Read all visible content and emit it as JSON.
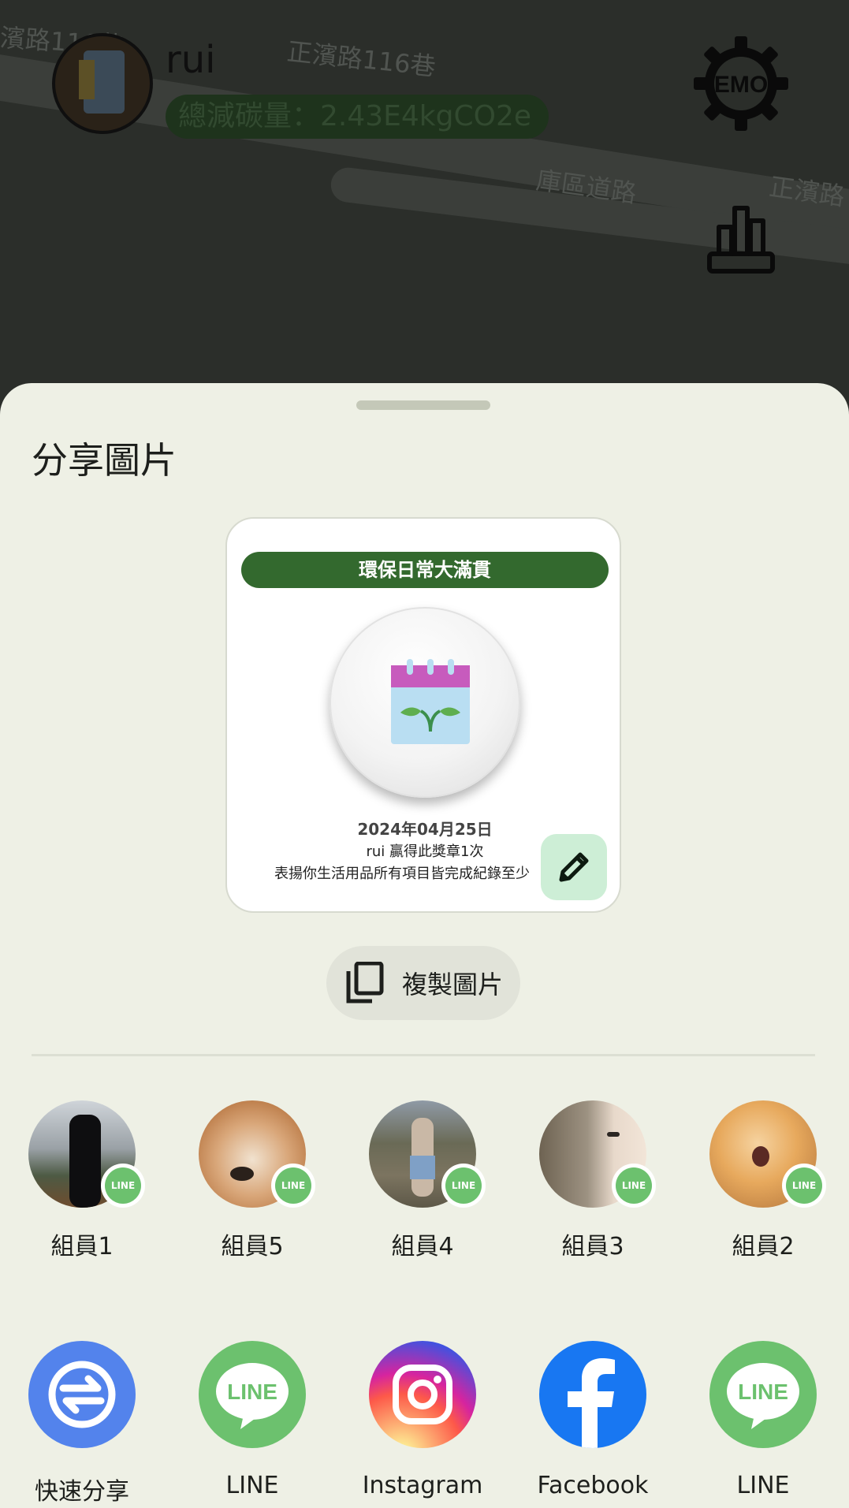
{
  "map": {
    "labels": [
      "濱路116巷",
      "正濱路116巷",
      "庫區道路",
      "正濱路"
    ]
  },
  "header": {
    "username": "rui",
    "carbon_text": "總減碳量：2.43E4kgCO2e",
    "settings_label": "EMO"
  },
  "sheet": {
    "title": "分享圖片",
    "card": {
      "banner": "環保日常大滿貫",
      "date": "2024年04月25日",
      "line2": "rui 贏得此獎章1次",
      "line3": "表揚你生活用品所有項目皆完成紀錄至少"
    },
    "copy_button": "複製圖片",
    "contacts": [
      {
        "name": "組員1",
        "badge": "LINE"
      },
      {
        "name": "組員5",
        "badge": "LINE"
      },
      {
        "name": "組員4",
        "badge": "LINE"
      },
      {
        "name": "組員3",
        "badge": "LINE"
      },
      {
        "name": "組員2",
        "badge": "LINE"
      }
    ],
    "apps": [
      {
        "name": "快速分享",
        "icon": "quick-share-icon",
        "color": "#5383ec"
      },
      {
        "name": "LINE",
        "icon": "line-icon",
        "color": "#6cc16e"
      },
      {
        "name": "Instagram",
        "icon": "instagram-icon",
        "color": "#d62976"
      },
      {
        "name": "Facebook",
        "icon": "facebook-icon",
        "color": "#1877f2"
      },
      {
        "name": "LINE",
        "icon": "line-icon",
        "color": "#6cc16e"
      }
    ]
  },
  "colors": {
    "accent_green": "#33692e",
    "sheet_bg": "#eef0e5",
    "scrim": "#2b2e2a"
  }
}
